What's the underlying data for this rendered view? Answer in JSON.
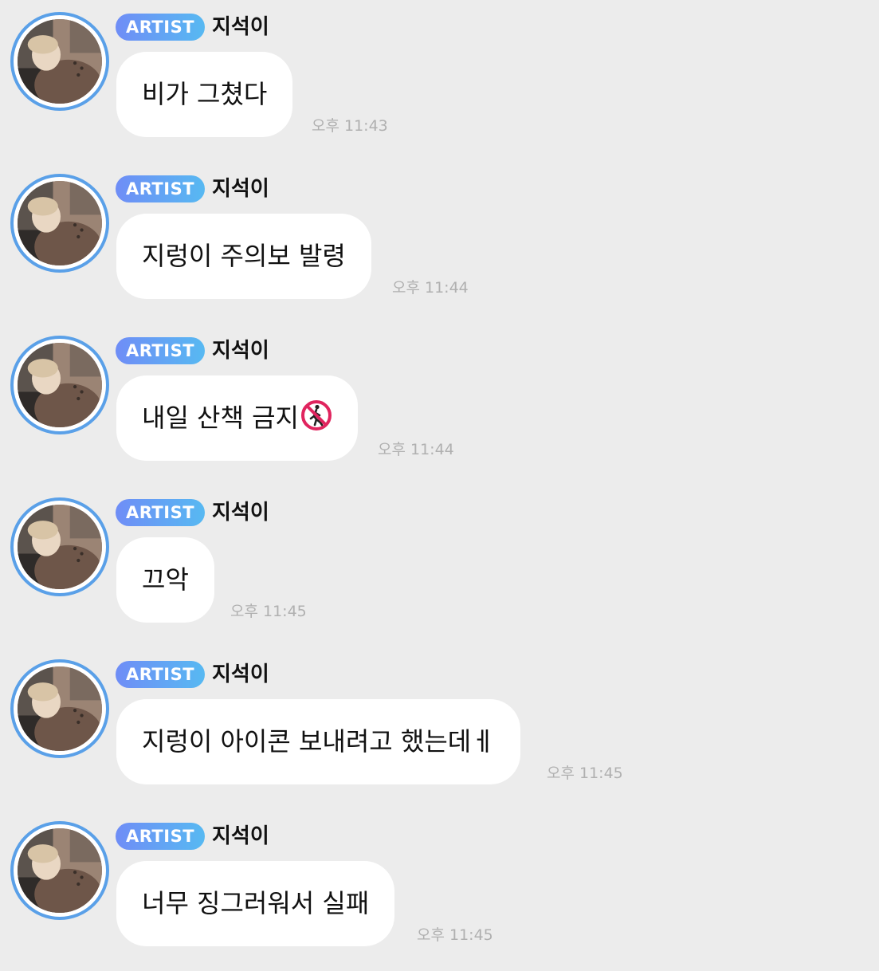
{
  "messages": [
    {
      "badge": "ARTIST",
      "sender": "지석이",
      "text": "비가 그쳤다",
      "time": "오후 11:43",
      "emoji": ""
    },
    {
      "badge": "ARTIST",
      "sender": "지석이",
      "text": "지렁이 주의보 발령",
      "time": "오후 11:44",
      "emoji": ""
    },
    {
      "badge": "ARTIST",
      "sender": "지석이",
      "text": "내일 산책 금지",
      "time": "오후 11:44",
      "emoji": "no-pedestrians-icon"
    },
    {
      "badge": "ARTIST",
      "sender": "지석이",
      "text": "끄악",
      "time": "오후 11:45",
      "emoji": ""
    },
    {
      "badge": "ARTIST",
      "sender": "지석이",
      "text": "지렁이 아이콘 보내려고 했는데ㅔ",
      "time": "오후 11:45",
      "emoji": ""
    },
    {
      "badge": "ARTIST",
      "sender": "지석이",
      "text": "너무 징그러워서 실패",
      "time": "오후 11:45",
      "emoji": ""
    }
  ],
  "colors": {
    "background": "#ececec",
    "bubble": "#ffffff",
    "badge_start": "#6f8df6",
    "badge_end": "#57b9f2",
    "avatar_ring": "#5aa0e8",
    "timestamp": "#b0b0b0"
  }
}
